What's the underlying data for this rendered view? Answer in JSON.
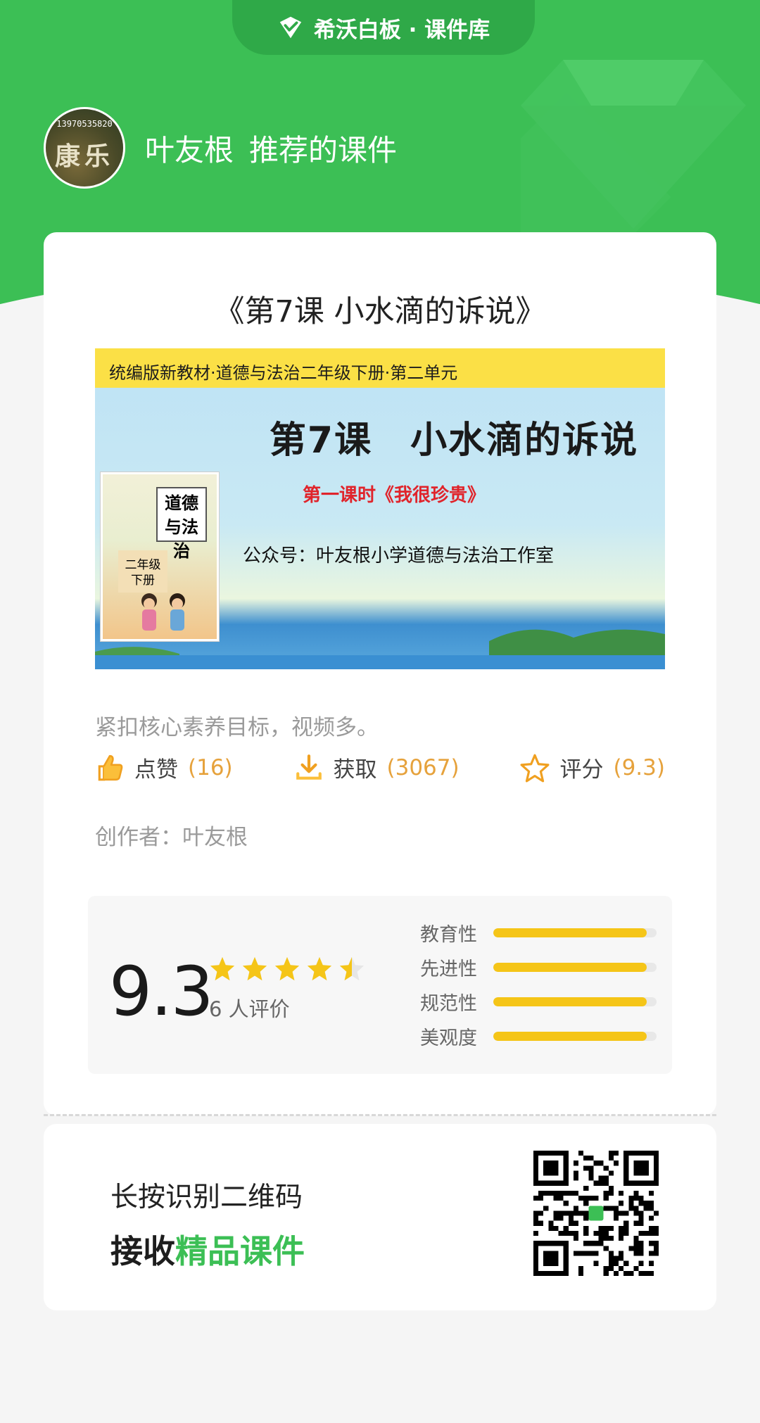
{
  "header": {
    "brand": "希沃白板 · 课件库",
    "author_name": "叶友根",
    "title_suffix": "推荐的课件",
    "avatar_phone": "13970535820",
    "avatar_text": "康乐"
  },
  "courseware": {
    "title": "《第7课 小水滴的诉说》",
    "cover": {
      "banner": "统编版新教材·道德与法治二年级下册·第二单元",
      "main_title": "第7课　小水滴的诉说",
      "sub_title": "第一课时《我很珍贵》",
      "official_account": "公众号：叶友根小学道德与法治工作室",
      "book_label": "道德与法治",
      "book_grade": "二年级 下册"
    },
    "description": "紧扣核心素养目标，视频多。",
    "stats": {
      "like_label": "点赞",
      "like_count": "(16)",
      "get_label": "获取",
      "get_count": "(3067)",
      "score_label": "评分",
      "score_count": "(9.3)"
    },
    "creator": "创作者：叶友根"
  },
  "rating": {
    "score": "9.3",
    "stars": 4.5,
    "review_count": "6 人评价",
    "dimensions": [
      {
        "label": "教育性",
        "value": 0.94
      },
      {
        "label": "先进性",
        "value": 0.94
      },
      {
        "label": "规范性",
        "value": 0.94
      },
      {
        "label": "美观度",
        "value": 0.94
      }
    ]
  },
  "qr": {
    "line1": "长按识别二维码",
    "line2_prefix": "接收",
    "line2_highlight": "精品课件"
  },
  "colors": {
    "brand_green": "#3cbf55",
    "accent_orange": "#e6a23c",
    "star_yellow": "#f5c518"
  }
}
